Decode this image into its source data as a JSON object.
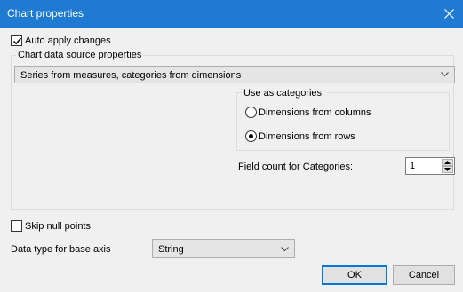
{
  "window": {
    "title": "Chart properties"
  },
  "auto_apply": {
    "label": "Auto apply changes",
    "checked": true
  },
  "data_source": {
    "legend": "Chart data source properties",
    "selected": "Series from measures, categories from dimensions"
  },
  "categories": {
    "legend": "Use as categories:",
    "options": [
      "Dimensions from columns",
      "Dimensions from rows"
    ],
    "selected_index": 1
  },
  "field_count": {
    "label": "Field count for Categories:",
    "value": "1"
  },
  "skip_null": {
    "label": "Skip null points",
    "checked": false
  },
  "base_axis": {
    "label": "Data type for base axis",
    "selected": "String"
  },
  "buttons": {
    "ok": "OK",
    "cancel": "Cancel"
  }
}
